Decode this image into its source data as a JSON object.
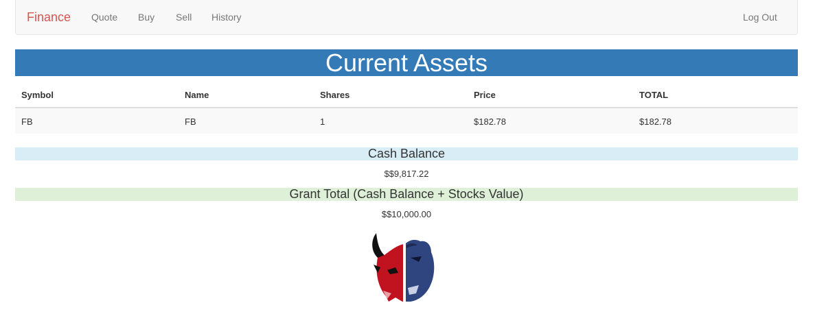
{
  "nav": {
    "brand": "Finance",
    "links": [
      "Quote",
      "Buy",
      "Sell",
      "History"
    ],
    "logout": "Log Out"
  },
  "assets": {
    "title": "Current Assets",
    "columns": [
      "Symbol",
      "Name",
      "Shares",
      "Price",
      "TOTAL"
    ],
    "rows": [
      [
        "FB",
        "FB",
        "1",
        "$182.78",
        "$182.78"
      ]
    ]
  },
  "cash": {
    "label": "Cash Balance",
    "value": "$$9,817.22"
  },
  "grand": {
    "label": "Grant Total (Cash Balance + Stocks Value)",
    "value": "$$10,000.00"
  },
  "colors": {
    "brand": "#d9534f",
    "header_bg": "#337ab7",
    "cash_bg": "#d9edf7",
    "grand_bg": "#dff0d8"
  },
  "logo": {
    "icon": "bull-bear-icon"
  }
}
